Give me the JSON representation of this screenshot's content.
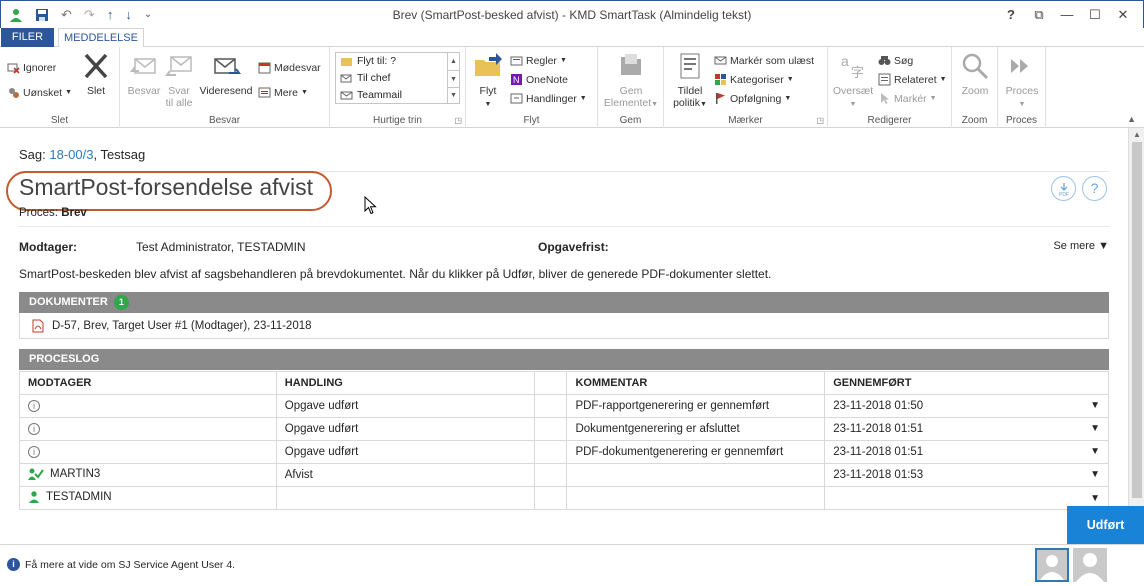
{
  "window": {
    "title": "Brev (SmartPost-besked afvist) - KMD SmartTask (Almindelig tekst)",
    "help": "?",
    "ctrl_restore": "⧉",
    "ctrl_min": "—",
    "ctrl_max": "☐",
    "ctrl_close": "✕"
  },
  "qat": {
    "undo": "↶",
    "redo": "↷",
    "up": "↑",
    "down": "↓",
    "more": "⌄"
  },
  "tabs": [
    {
      "label": "FILER"
    },
    {
      "label": "MEDDELELSE"
    }
  ],
  "ribbon": {
    "slet": {
      "label": "Slet",
      "ignorer": "Ignorer",
      "uonsket": "Uønsket",
      "slet": "Slet"
    },
    "besvar": {
      "label": "Besvar",
      "besvar": "Besvar",
      "svar_til_alle_1": "Svar",
      "svar_til_alle_2": "til alle",
      "videresend": "Videresend",
      "modesvar": "Mødesvar",
      "mere": "Mere"
    },
    "hurtige_trin": {
      "label": "Hurtige trin",
      "items": [
        "Flyt til: ?",
        "Til chef",
        "Teammail"
      ]
    },
    "flyt": {
      "label": "Flyt",
      "flyt": "Flyt",
      "regler": "Regler",
      "onenote": "OneNote",
      "handlinger": "Handlinger"
    },
    "gem": {
      "label": "Gem",
      "gem_1": "Gem",
      "gem_2": "Elementet"
    },
    "maerker": {
      "label": "Mærker",
      "tildel_1": "Tildel",
      "tildel_2": "politik",
      "marker_ulaest": "Markér som ulæst",
      "kategoriser": "Kategoriser",
      "opfolgning": "Opfølgning"
    },
    "rediger": {
      "label": "Redigerer",
      "oversaet": "Oversæt",
      "sog": "Søg",
      "relateret": "Relateret",
      "marker": "Markér"
    },
    "zoom": {
      "label": "Zoom",
      "zoom": "Zoom"
    },
    "proces": {
      "label": "Proces",
      "proces": "Proces"
    }
  },
  "case": {
    "prefix": "Sag: ",
    "link": "18-00/3",
    "suffix": ", Testsag"
  },
  "heading": "SmartPost-forsendelse afvist",
  "proces": {
    "label": "Proces: ",
    "value": "Brev"
  },
  "modtager": {
    "label": "Modtager:",
    "value": "Test Administrator, TESTADMIN"
  },
  "opgavefrist": {
    "label": "Opgavefrist:",
    "value": ""
  },
  "se_mere": "Se mere",
  "description": "SmartPost-beskeden blev afvist af sagsbehandleren på brevdokumentet. Når du klikker på Udfør, bliver de generede PDF-dokumenter slettet.",
  "documents": {
    "header": "DOKUMENTER",
    "count": "1",
    "items": [
      "D-57, Brev, Target User #1 (Modtager), 23-11-2018"
    ]
  },
  "proceslog": {
    "header": "PROCESLOG",
    "columns": [
      "MODTAGER",
      "HANDLING",
      "",
      "KOMMENTAR",
      "GENNEMFØRT"
    ],
    "rows": [
      {
        "modtager": "",
        "handling": "Opgave udført",
        "kommentar": "PDF-rapportgenerering er gennemført",
        "gennemfort": "23-11-2018 01:50"
      },
      {
        "modtager": "",
        "handling": "Opgave udført",
        "kommentar": "Dokumentgenerering er afsluttet",
        "gennemfort": "23-11-2018 01:51"
      },
      {
        "modtager": "",
        "handling": "Opgave udført",
        "kommentar": "PDF-dokumentgenerering er gennemført",
        "gennemfort": "23-11-2018 01:51"
      },
      {
        "modtager": "MARTIN3",
        "handling": "Afvist",
        "kommentar": "",
        "gennemfort": "23-11-2018 01:53"
      },
      {
        "modtager": "TESTADMIN",
        "handling": "",
        "kommentar": "",
        "gennemfort": ""
      }
    ]
  },
  "udfor_label": "Udført",
  "status": {
    "text": "Få mere at vide om SJ Service Agent User 4."
  },
  "colors": {
    "accent": "#2b579a",
    "link": "#2b7bba",
    "circle": "#c55a2c",
    "button": "#1883d7",
    "badge": "#2ea84a"
  }
}
